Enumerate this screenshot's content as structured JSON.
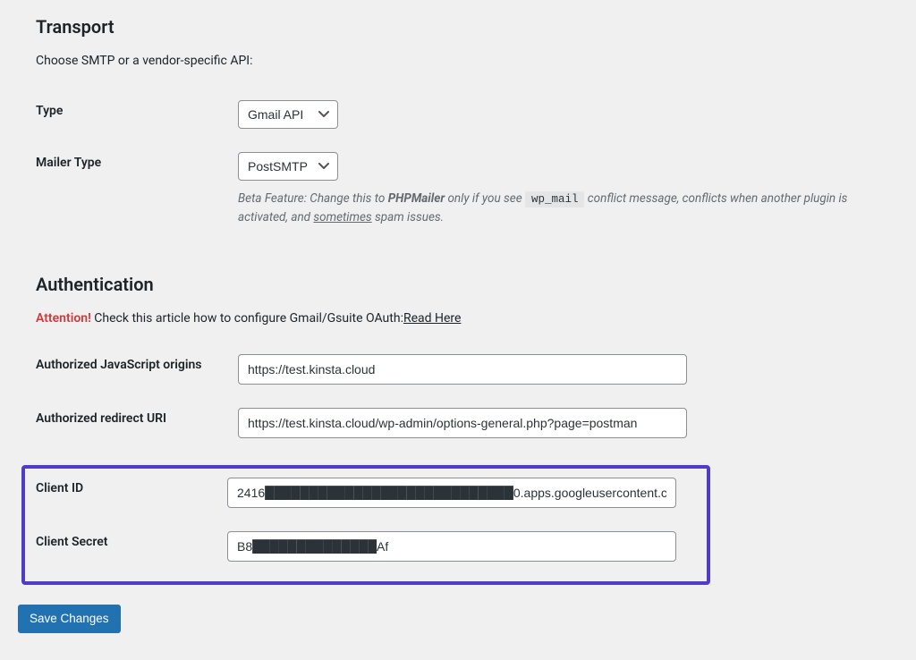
{
  "transport": {
    "title": "Transport",
    "intro": "Choose SMTP or a vendor-specific API:",
    "type_label": "Type",
    "type_value": "Gmail API",
    "mailer_label": "Mailer Type",
    "mailer_value": "PostSMTP",
    "beta_1": "Beta Feature: Change this to ",
    "beta_bold": "PHPMailer",
    "beta_2": " only if you see ",
    "beta_code": "wp_mail",
    "beta_3": " conflict message, conflicts when another plugin is activated, and ",
    "beta_ul": "sometimes",
    "beta_4": " spam issues."
  },
  "auth": {
    "title": "Authentication",
    "attention": "Attention!",
    "attention_text": " Check this article how to configure Gmail/Gsuite OAuth:",
    "read_here": "Read Here",
    "js_origins_label": "Authorized JavaScript origins",
    "js_origins_value": "https://test.kinsta.cloud",
    "redirect_label": "Authorized redirect URI",
    "redirect_value": "https://test.kinsta.cloud/wp-admin/options-general.php?page=postman",
    "client_id_label": "Client ID",
    "client_id_value": "2416████████████████████████████0.apps.googleusercontent.c",
    "client_secret_label": "Client Secret",
    "client_secret_value": "B8██████████████Af"
  },
  "save_button": "Save Changes"
}
